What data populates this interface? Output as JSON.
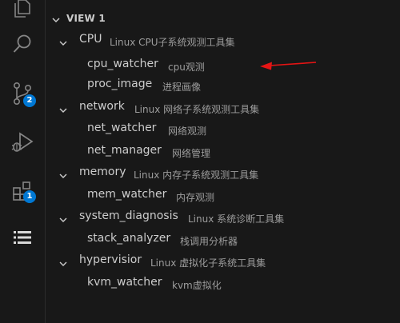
{
  "activity_bar": {
    "items": [
      {
        "name": "explorer",
        "icon": "files-icon"
      },
      {
        "name": "search",
        "icon": "search-icon"
      },
      {
        "name": "source-control",
        "icon": "source-control-icon",
        "badge": "2"
      },
      {
        "name": "run-debug",
        "icon": "run-debug-icon"
      },
      {
        "name": "extensions",
        "icon": "extensions-icon",
        "badge": "1"
      },
      {
        "name": "tree-view",
        "icon": "list-tree-icon"
      }
    ],
    "badge_color": "#0078d4"
  },
  "view": {
    "title": "VIEW 1",
    "groups": [
      {
        "label": "CPU",
        "description": "Linux CPU子系统观测工具集",
        "children": [
          {
            "label": "cpu_watcher",
            "description": "cpu观测"
          },
          {
            "label": "proc_image",
            "description": "进程画像"
          }
        ]
      },
      {
        "label": "network",
        "description": "Linux 网络子系统观测工具集",
        "children": [
          {
            "label": "net_watcher",
            "description": "网络观测"
          },
          {
            "label": "net_manager",
            "description": "网络管理"
          }
        ]
      },
      {
        "label": "memory",
        "description": "Linux 内存子系统观测工具集",
        "children": [
          {
            "label": "mem_watcher",
            "description": "内存观测"
          }
        ]
      },
      {
        "label": "system_diagnosis",
        "description": "Linux 系统诊断工具集",
        "children": [
          {
            "label": "stack_analyzer",
            "description": "栈调用分析器"
          }
        ]
      },
      {
        "label": "hypervisior",
        "description": "Linux 虚拟化子系统工具集",
        "children": [
          {
            "label": "kvm_watcher",
            "description": "kvm虚拟化"
          }
        ]
      }
    ]
  },
  "colors": {
    "background": "#181818",
    "text": "#cccccc",
    "description": "#9d9d9d",
    "annotation_arrow": "#e51414"
  }
}
